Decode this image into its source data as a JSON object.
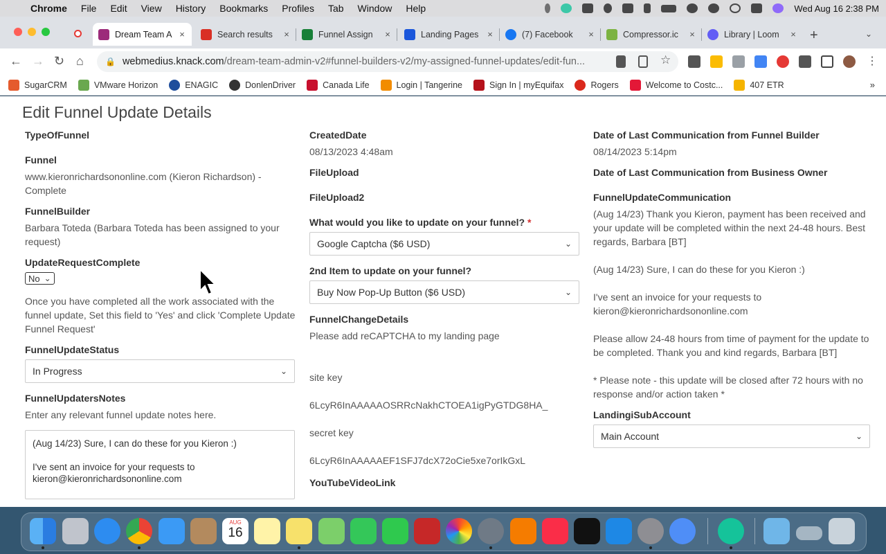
{
  "menubar": {
    "app": "Chrome",
    "items": [
      "File",
      "Edit",
      "View",
      "History",
      "Bookmarks",
      "Profiles",
      "Tab",
      "Window",
      "Help"
    ],
    "clock": "Wed Aug 16  2:38 PM"
  },
  "tabs": [
    {
      "title": "Dream Team A",
      "icon": "knack-icon",
      "color": "#9c2b7a",
      "active": true
    },
    {
      "title": "Search results",
      "icon": "gmail-icon",
      "color": "#d93025",
      "active": false
    },
    {
      "title": "Funnel Assign",
      "icon": "sheets-icon",
      "color": "#188038",
      "active": false
    },
    {
      "title": "Landing Pages",
      "icon": "landingi-icon",
      "color": "#1a56db",
      "active": false
    },
    {
      "title": "(7) Facebook",
      "icon": "facebook-icon",
      "color": "#1877f2",
      "active": false
    },
    {
      "title": "Compressor.ic",
      "icon": "compressor-icon",
      "color": "#7cb342",
      "active": false
    },
    {
      "title": "Library | Loom",
      "icon": "loom-icon",
      "color": "#625df5",
      "active": false
    }
  ],
  "url": {
    "host": "webmedius.knack.com",
    "path": "/dream-team-admin-v2#funnel-builders-v2/my-assigned-funnel-updates/edit-fun..."
  },
  "bookmarks": [
    {
      "label": "SugarCRM",
      "icon": "sugarcrm-icon",
      "color": "#e55b2d"
    },
    {
      "label": "VMware Horizon",
      "icon": "vmware-icon",
      "color": "#6aa84f"
    },
    {
      "label": "ENAGIC",
      "icon": "enagic-icon",
      "color": "#1f4e9c"
    },
    {
      "label": "DonlenDriver",
      "icon": "donlen-icon",
      "color": "#333333"
    },
    {
      "label": "Canada Life",
      "icon": "canadalife-icon",
      "color": "#c8102e"
    },
    {
      "label": "Login | Tangerine",
      "icon": "tangerine-icon",
      "color": "#f28c00"
    },
    {
      "label": "Sign In | myEquifax",
      "icon": "equifax-icon",
      "color": "#b5121b"
    },
    {
      "label": "Rogers",
      "icon": "rogers-icon",
      "color": "#da291c"
    },
    {
      "label": "Welcome to Costc...",
      "icon": "costco-icon",
      "color": "#e31837"
    },
    {
      "label": "407 ETR",
      "icon": "etr-icon",
      "color": "#f5b400"
    }
  ],
  "page": {
    "title": "Edit Funnel Update Details",
    "col1": {
      "type_label": "TypeOfFunnel",
      "funnel_label": "Funnel",
      "funnel_value": "www.kieronrichardsononline.com (Kieron Richardson) - Complete",
      "builder_label": "FunnelBuilder",
      "builder_value": "Barbara Toteda (Barbara Toteda has been assigned to your request)",
      "complete_label": "UpdateRequestComplete",
      "complete_value": "No",
      "complete_help": "Once you have completed all the work associated with the funnel update, Set this field to 'Yes' and click 'Complete Update Funnel Request'",
      "status_label": "FunnelUpdateStatus",
      "status_value": "In Progress",
      "notes_label": "FunnelUpdatersNotes",
      "notes_help": "Enter any relevant funnel update notes here.",
      "notes_line1": "(Aug 14/23) Sure, I can do these for you Kieron :)",
      "notes_line2": "I've sent an invoice for your requests to",
      "notes_line3": "kieron@kieronrichardsononline.com"
    },
    "col2": {
      "created_label": "CreatedDate",
      "created_value": "08/13/2023 4:48am",
      "file_label": "FileUpload",
      "file2_label": "FileUpload2",
      "update_label": "What would you like to update on your funnel?",
      "required_mark": "*",
      "update_value": "Google Captcha ($6 USD)",
      "second_label": "2nd Item to update on your funnel?",
      "second_value": "Buy Now Pop-Up Button ($6 USD)",
      "change_label": "FunnelChangeDetails",
      "change_line1": "Please add reCAPTCHA to my landing page",
      "change_line2": "site key",
      "change_line3": "6LcyR6InAAAAAOSRRcNakhCTOEA1igPyGTDG8HA_",
      "change_line4": "secret key",
      "change_line5": "6LcyR6InAAAAAEF1SFJ7dcX72oCie5xe7orIkGxL",
      "youtube_label": "YouTubeVideoLink"
    },
    "col3": {
      "builder_comm_label": "Date of Last Communication from Funnel Builder",
      "builder_comm_value": "08/14/2023 5:14pm",
      "owner_comm_label": "Date of Last Communication from Business Owner",
      "comm_label": "FunnelUpdateCommunication",
      "comm_p1": "(Aug 14/23) Thank you Kieron, payment has been received and your update will be completed within the next 24-48 hours. Best regards, Barbara [BT]",
      "comm_p2": "(Aug 14/23) Sure, I can do these for you Kieron :)",
      "comm_p3": "I've sent an invoice for your requests to kieron@kieronrichardsononline.com",
      "comm_p4": "Please allow 24-48 hours from time of payment for the update to be completed. Thank you and kind regards, Barbara [BT]",
      "comm_p5": "* Please note - this update will be closed after 72 hours with no response and/or action taken *",
      "landingi_label": "LandingiSubAccount",
      "landingi_value": "Main Account"
    }
  },
  "dock": {
    "calendar_month": "AUG",
    "calendar_day": "16"
  }
}
